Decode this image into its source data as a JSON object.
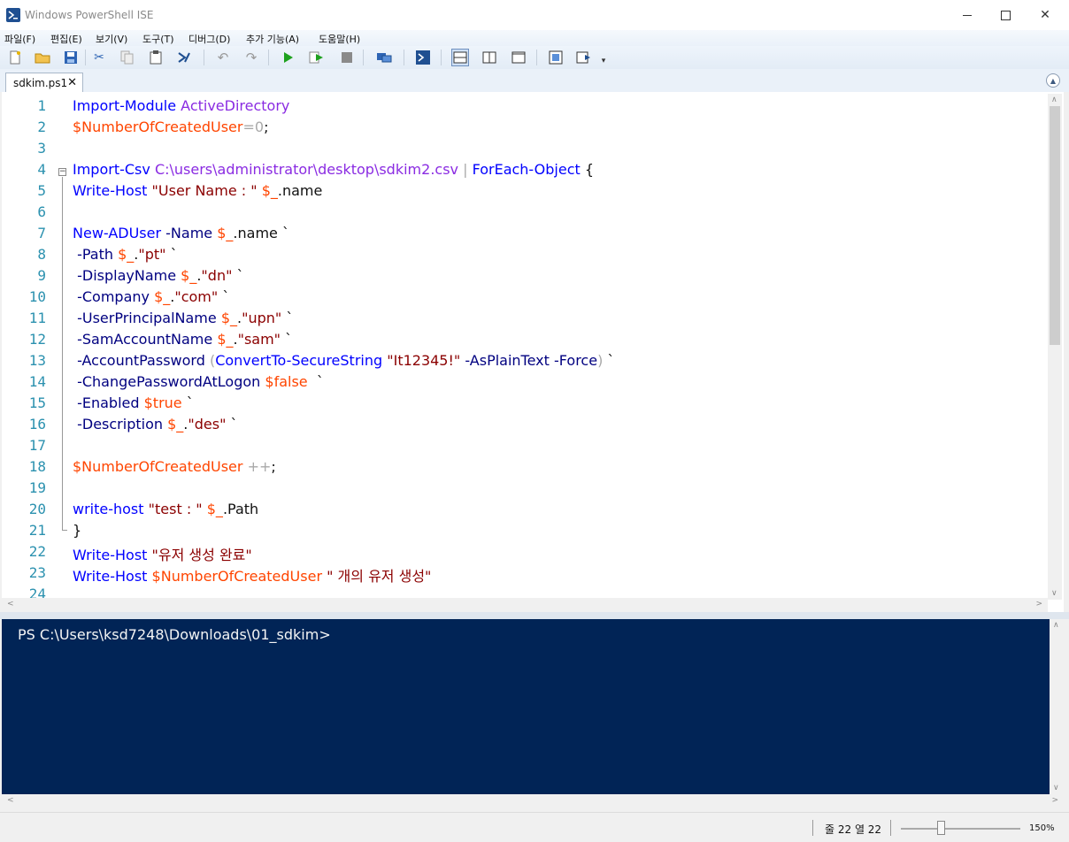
{
  "window": {
    "title": "Windows PowerShell ISE"
  },
  "menu": [
    "파일(F)",
    "편집(E)",
    "보기(V)",
    "도구(T)",
    "디버그(D)",
    "추가 기능(A)",
    "도움말(H)"
  ],
  "tab": {
    "label": "sdkim.ps1",
    "close": "✕"
  },
  "editor": {
    "line_numbers": [
      "1",
      "2",
      "3",
      "4",
      "5",
      "6",
      "7",
      "8",
      "9",
      "10",
      "11",
      "12",
      "13",
      "14",
      "15",
      "16",
      "17",
      "18",
      "19",
      "20",
      "21",
      "22",
      "23",
      "24"
    ],
    "lines": [
      [
        {
          "t": "Import-Module",
          "c": "cmd"
        },
        {
          "t": " "
        },
        {
          "t": "ActiveDirectory",
          "c": "arg"
        }
      ],
      [
        {
          "t": "$NumberOfCreatedUser",
          "c": "var"
        },
        {
          "t": "=",
          "c": "op"
        },
        {
          "t": "0",
          "c": "op"
        },
        {
          "t": ";"
        }
      ],
      [],
      [
        {
          "t": "Import-Csv",
          "c": "cmd"
        },
        {
          "t": " "
        },
        {
          "t": "C:\\users\\administrator\\desktop\\sdkim2.csv",
          "c": "arg"
        },
        {
          "t": " "
        },
        {
          "t": "|",
          "c": "op"
        },
        {
          "t": " "
        },
        {
          "t": "ForEach-Object",
          "c": "cmd"
        },
        {
          "t": " {"
        }
      ],
      [
        {
          "t": "Write-Host",
          "c": "cmd"
        },
        {
          "t": " "
        },
        {
          "t": "\"User Name : \"",
          "c": "str"
        },
        {
          "t": " "
        },
        {
          "t": "$_",
          "c": "var"
        },
        {
          "t": ".name"
        }
      ],
      [],
      [
        {
          "t": "New-ADUser",
          "c": "cmd"
        },
        {
          "t": " "
        },
        {
          "t": "-Name",
          "c": "param"
        },
        {
          "t": " "
        },
        {
          "t": "$_",
          "c": "var"
        },
        {
          "t": ".name `"
        }
      ],
      [
        {
          "t": " "
        },
        {
          "t": "-Path",
          "c": "param"
        },
        {
          "t": " "
        },
        {
          "t": "$_",
          "c": "var"
        },
        {
          "t": "."
        },
        {
          "t": "\"pt\"",
          "c": "str"
        },
        {
          "t": " `"
        }
      ],
      [
        {
          "t": " "
        },
        {
          "t": "-DisplayName",
          "c": "param"
        },
        {
          "t": " "
        },
        {
          "t": "$_",
          "c": "var"
        },
        {
          "t": "."
        },
        {
          "t": "\"dn\"",
          "c": "str"
        },
        {
          "t": " `"
        }
      ],
      [
        {
          "t": " "
        },
        {
          "t": "-Company",
          "c": "param"
        },
        {
          "t": " "
        },
        {
          "t": "$_",
          "c": "var"
        },
        {
          "t": "."
        },
        {
          "t": "\"com\"",
          "c": "str"
        },
        {
          "t": " `"
        }
      ],
      [
        {
          "t": " "
        },
        {
          "t": "-UserPrincipalName",
          "c": "param"
        },
        {
          "t": " "
        },
        {
          "t": "$_",
          "c": "var"
        },
        {
          "t": "."
        },
        {
          "t": "\"upn\"",
          "c": "str"
        },
        {
          "t": " `"
        }
      ],
      [
        {
          "t": " "
        },
        {
          "t": "-SamAccountName",
          "c": "param"
        },
        {
          "t": " "
        },
        {
          "t": "$_",
          "c": "var"
        },
        {
          "t": "."
        },
        {
          "t": "\"sam\"",
          "c": "str"
        },
        {
          "t": " `"
        }
      ],
      [
        {
          "t": " "
        },
        {
          "t": "-AccountPassword",
          "c": "param"
        },
        {
          "t": " "
        },
        {
          "t": "(",
          "c": "op"
        },
        {
          "t": "ConvertTo-SecureString",
          "c": "cmd"
        },
        {
          "t": " "
        },
        {
          "t": "\"It12345!\"",
          "c": "str"
        },
        {
          "t": " "
        },
        {
          "t": "-AsPlainText",
          "c": "param"
        },
        {
          "t": " "
        },
        {
          "t": "-Force",
          "c": "param"
        },
        {
          "t": ")",
          "c": "op"
        },
        {
          "t": " `"
        }
      ],
      [
        {
          "t": " "
        },
        {
          "t": "-ChangePasswordAtLogon",
          "c": "param"
        },
        {
          "t": " "
        },
        {
          "t": "$false",
          "c": "var"
        },
        {
          "t": "  `"
        }
      ],
      [
        {
          "t": " "
        },
        {
          "t": "-Enabled",
          "c": "param"
        },
        {
          "t": " "
        },
        {
          "t": "$true",
          "c": "var"
        },
        {
          "t": " `"
        }
      ],
      [
        {
          "t": " "
        },
        {
          "t": "-Description",
          "c": "param"
        },
        {
          "t": " "
        },
        {
          "t": "$_",
          "c": "var"
        },
        {
          "t": "."
        },
        {
          "t": "\"des\"",
          "c": "str"
        },
        {
          "t": " `"
        }
      ],
      [],
      [
        {
          "t": "$NumberOfCreatedUser",
          "c": "var"
        },
        {
          "t": " "
        },
        {
          "t": "++",
          "c": "op"
        },
        {
          "t": ";"
        }
      ],
      [],
      [
        {
          "t": "write-host",
          "c": "cmd"
        },
        {
          "t": " "
        },
        {
          "t": "\"test : \"",
          "c": "str"
        },
        {
          "t": " "
        },
        {
          "t": "$_",
          "c": "var"
        },
        {
          "t": ".Path"
        }
      ],
      [
        {
          "t": "}"
        }
      ],
      [
        {
          "t": "Write-Host",
          "c": "cmd"
        },
        {
          "t": " "
        },
        {
          "t": "\"유저 생성 완료\"",
          "c": "str"
        }
      ],
      [
        {
          "t": "Write-Host",
          "c": "cmd"
        },
        {
          "t": " "
        },
        {
          "t": "$NumberOfCreatedUser",
          "c": "var"
        },
        {
          "t": " "
        },
        {
          "t": "\" 개의 유저 생성\"",
          "c": "str"
        }
      ],
      []
    ]
  },
  "console": {
    "prompt": "PS C:\\Users\\ksd7248\\Downloads\\01_sdkim>"
  },
  "status": {
    "position": "줄 22  열 22",
    "zoom": "150%",
    "zoom_level": 0.3
  },
  "colors": {
    "console_bg": "#012456",
    "cmd": "#0000ff",
    "var": "#ff4500",
    "str": "#8b0000",
    "arg": "#8a2be2",
    "param": "#000080"
  }
}
